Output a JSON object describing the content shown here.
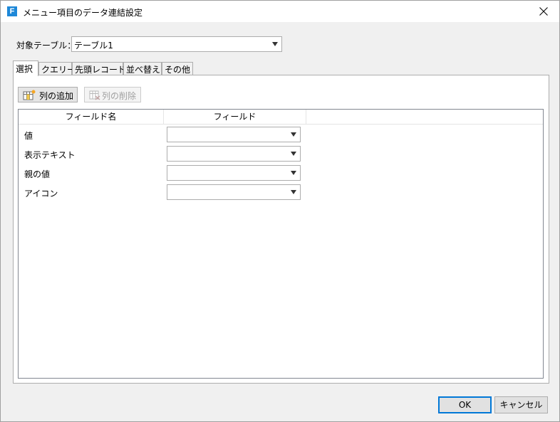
{
  "window": {
    "title": "メニュー項目のデータ連結設定",
    "app_icon_letter": "F"
  },
  "target": {
    "label": "対象テーブル：",
    "value": "テーブル1"
  },
  "tabs": [
    {
      "label": "選択",
      "active": true
    },
    {
      "label": "クエリー",
      "active": false
    },
    {
      "label": "先頭レコード",
      "active": false
    },
    {
      "label": "並べ替え",
      "active": false
    },
    {
      "label": "その他",
      "active": false
    }
  ],
  "toolbar": {
    "add_column": "列の追加",
    "delete_column": "列の削除"
  },
  "grid": {
    "columns": [
      "フィールド名",
      "フィールド"
    ],
    "rows": [
      {
        "name": "値",
        "field": ""
      },
      {
        "name": "表示テキスト",
        "field": ""
      },
      {
        "name": "親の値",
        "field": ""
      },
      {
        "name": "アイコン",
        "field": ""
      }
    ]
  },
  "footer": {
    "ok": "OK",
    "cancel": "キャンセル"
  },
  "colors": {
    "accent": "#0078d7",
    "app_icon": "#1e88d8"
  },
  "icons": {
    "close": "close-icon",
    "add_column": "add-column-icon",
    "delete_column": "delete-column-icon"
  }
}
